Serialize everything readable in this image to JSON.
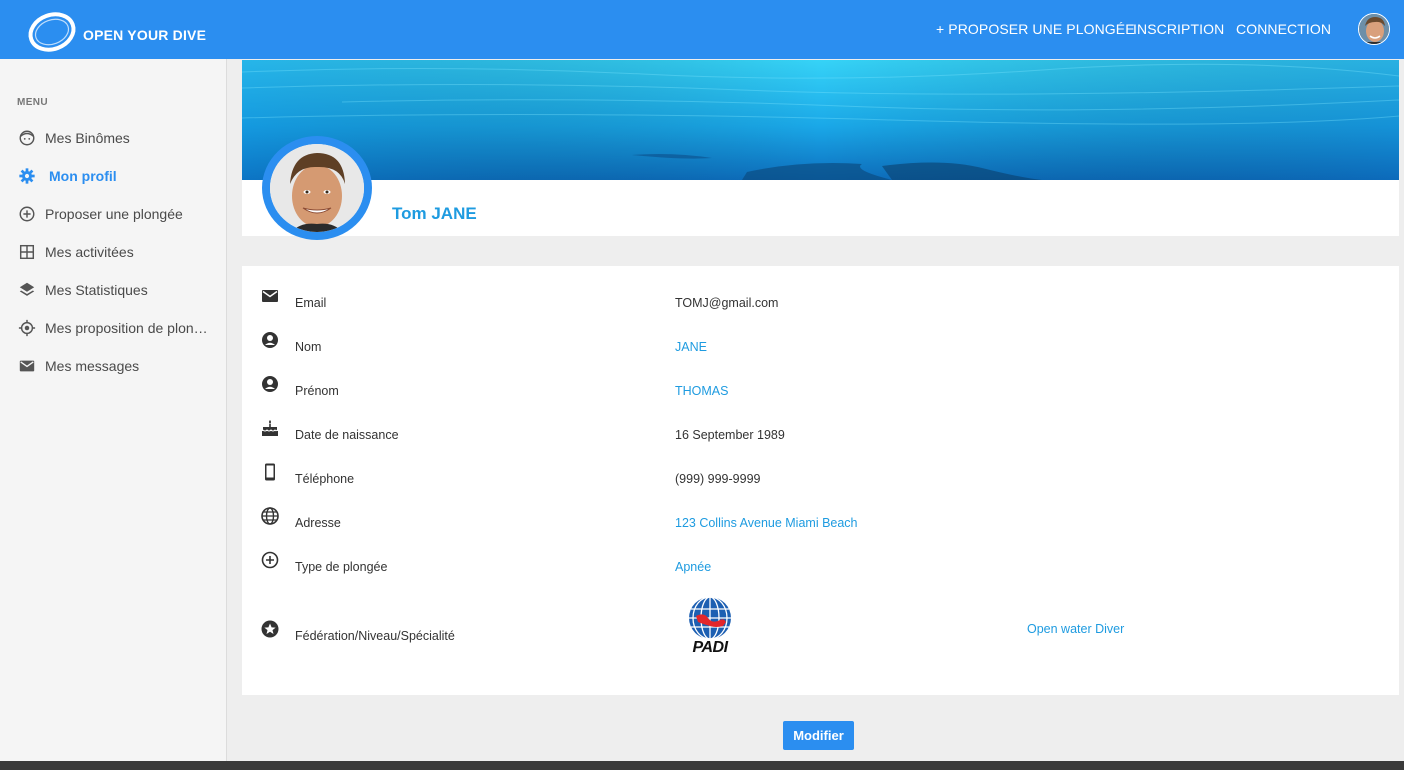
{
  "header": {
    "brand": "OPEN YOUR DIVE",
    "nav": {
      "propose": "+ PROPOSER UNE PLONGÉE",
      "register": "INSCRIPTION",
      "login": "CONNECTION"
    }
  },
  "sidebar": {
    "title": "MENU",
    "items": [
      {
        "label": "Mes Binômes",
        "icon": "face-icon"
      },
      {
        "label": "Mon profil",
        "icon": "gear-icon"
      },
      {
        "label": "Proposer une plongée",
        "icon": "add-circle-icon"
      },
      {
        "label": "Mes activitées",
        "icon": "grid-icon"
      },
      {
        "label": "Mes Statistiques",
        "icon": "layers-icon"
      },
      {
        "label": "Mes proposition de plongée",
        "icon": "target-icon"
      },
      {
        "label": "Mes messages",
        "icon": "mail-icon"
      }
    ]
  },
  "profile": {
    "name": "Tom JANE"
  },
  "details": {
    "email_label": "Email",
    "email": "TOMJ@gmail.com",
    "lastname_label": "Nom",
    "lastname": "JANE",
    "firstname_label": "Prénom",
    "firstname": "THOMAS",
    "birthdate_label": "Date de naissance",
    "birthdate": "16 September 1989",
    "phone_label": "Téléphone",
    "phone": "(999) 999-9999",
    "address_label": "Adresse",
    "address": "123 Collins Avenue Miami Beach",
    "divetype_label": "Type de plongée",
    "divetype": "Apnée",
    "federation_label": "Fédération/Niveau/Spécialité",
    "federation_logo_text": "PADI",
    "level": "Open water Diver"
  },
  "actions": {
    "edit": "Modifier"
  },
  "colors": {
    "accent": "#2b8ef0",
    "link": "#1e9be0"
  }
}
